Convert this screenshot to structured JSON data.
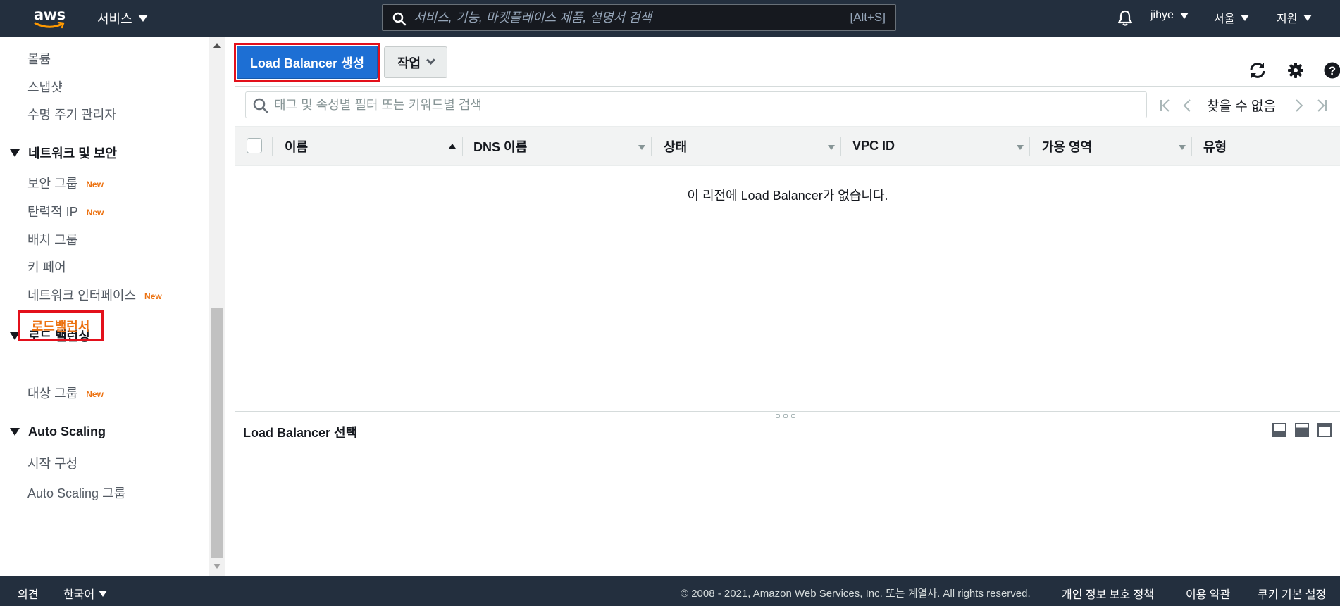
{
  "header": {
    "logo_text": "aws",
    "services_label": "서비스",
    "search_placeholder": "서비스, 기능, 마켓플레이스 제품, 설명서 검색",
    "search_shortcut": "[Alt+S]",
    "user": "jihye",
    "region": "서울",
    "support": "지원",
    "icons": {
      "search": "search-icon",
      "bell": "bell-icon"
    }
  },
  "sidebar": {
    "top_items": [
      {
        "label": "볼륨"
      },
      {
        "label": "스냅샷"
      },
      {
        "label": "수명 주기 관리자"
      }
    ],
    "sections": [
      {
        "title": "네트워크 및 보안",
        "items": [
          {
            "label": "보안 그룹",
            "badge": "New"
          },
          {
            "label": "탄력적 IP",
            "badge": "New"
          },
          {
            "label": "배치 그룹"
          },
          {
            "label": "키 페어"
          },
          {
            "label": "네트워크 인터페이스",
            "badge": "New"
          }
        ]
      },
      {
        "title": "로드 밸런싱",
        "items": [
          {
            "label": "로드밸런서",
            "active": true
          },
          {
            "label": "대상 그룹",
            "badge": "New"
          }
        ]
      },
      {
        "title": "Auto Scaling",
        "items": [
          {
            "label": "시작 구성"
          },
          {
            "label": "Auto Scaling 그룹"
          }
        ]
      }
    ]
  },
  "toolbar": {
    "create_label": "Load Balancer 생성",
    "actions_label": "작업",
    "icons": {
      "refresh": "refresh-icon",
      "settings": "gear-icon",
      "help": "help-icon"
    }
  },
  "filter": {
    "placeholder": "태그 및 속성별 필터 또는 키워드별 검색",
    "pager_text": "찾을 수 없음"
  },
  "table": {
    "columns": [
      "이름",
      "DNS 이름",
      "상태",
      "VPC ID",
      "가용 영역",
      "유형"
    ],
    "sorted_column": "이름",
    "empty_message": "이 리전에 Load Balancer가 없습니다."
  },
  "detail": {
    "title": "Load Balancer 선택"
  },
  "footer": {
    "feedback": "의견",
    "language": "한국어",
    "copyright": "© 2008 - 2021, Amazon Web Services, Inc. 또는 계열사. All rights reserved.",
    "privacy": "개인 정보 보호 정책",
    "terms": "이용 약관",
    "cookies": "쿠키 기본 설정"
  },
  "colors": {
    "nav_bg": "#232f3e",
    "primary_button": "#1d6fd4",
    "highlight_border": "#e3101b",
    "accent_orange": "#ec7211"
  }
}
